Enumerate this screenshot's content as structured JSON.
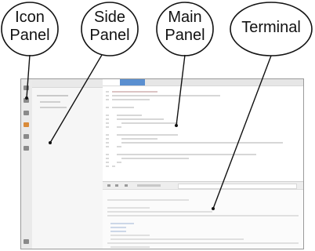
{
  "callouts": {
    "icon_panel": {
      "line1": "Icon",
      "line2": "Panel"
    },
    "side_panel": {
      "line1": "Side",
      "line2": "Panel"
    },
    "main_panel": {
      "line1": "Main",
      "line2": "Panel"
    },
    "terminal": {
      "label": "Terminal"
    }
  }
}
